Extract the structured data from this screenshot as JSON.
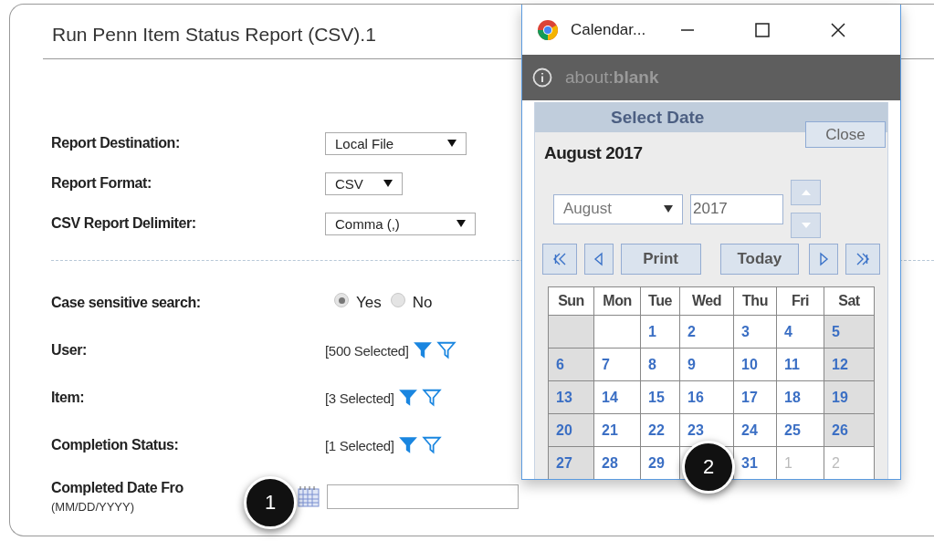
{
  "page": {
    "title": "Run Penn Item Status Report (CSV).1"
  },
  "selects": [
    {
      "label": "Report Destination:",
      "value": "Local File"
    },
    {
      "label": "Report Format:",
      "value": "CSV"
    },
    {
      "label": "CSV Report Delimiter:",
      "value": "Comma (,)"
    }
  ],
  "case_sensitive": {
    "label": "Case sensitive search:",
    "options": [
      {
        "label": "Yes",
        "selected": true
      },
      {
        "label": "No",
        "selected": false
      }
    ]
  },
  "filters": [
    {
      "label": "User:",
      "value": "[500 Selected]"
    },
    {
      "label": "Item:",
      "value": "[3 Selected]"
    },
    {
      "label": "Completion Status:",
      "value": "[1 Selected]"
    }
  ],
  "date_from": {
    "label": "Completed Date Fro",
    "hint": "(MM/DD/YYYY)"
  },
  "popup": {
    "title": "Calendar...",
    "address": "about:**blank**",
    "header": "Select Date",
    "close_button": "Close",
    "month_title": "August 2017",
    "month_select": "August",
    "year_value": "2017",
    "print_button": "Print",
    "today_button": "Today",
    "weekdays": [
      "Sun",
      "Mon",
      "Tue",
      "Wed",
      "Thu",
      "Fri",
      "Sat"
    ],
    "weeks": [
      [
        {
          "kind": "empty"
        },
        {
          "kind": "empty"
        },
        {
          "day": "1",
          "other_month": false
        },
        {
          "day": "2",
          "other_month": false
        },
        {
          "day": "3",
          "other_month": false
        },
        {
          "day": "4",
          "other_month": false
        },
        {
          "day": "5",
          "other_month": false
        }
      ],
      [
        {
          "day": "6",
          "other_month": false
        },
        {
          "day": "7",
          "other_month": false
        },
        {
          "day": "8",
          "other_month": false
        },
        {
          "day": "9",
          "other_month": false
        },
        {
          "day": "10",
          "other_month": false
        },
        {
          "day": "11",
          "other_month": false
        },
        {
          "day": "12",
          "other_month": false
        }
      ],
      [
        {
          "day": "13",
          "other_month": false
        },
        {
          "day": "14",
          "other_month": false
        },
        {
          "day": "15",
          "other_month": false
        },
        {
          "day": "16",
          "other_month": false
        },
        {
          "day": "17",
          "other_month": false
        },
        {
          "day": "18",
          "other_month": false
        },
        {
          "day": "19",
          "other_month": false
        }
      ],
      [
        {
          "day": "20",
          "other_month": false
        },
        {
          "day": "21",
          "other_month": false
        },
        {
          "day": "22",
          "other_month": false
        },
        {
          "day": "23",
          "other_month": false
        },
        {
          "day": "24",
          "other_month": false
        },
        {
          "day": "25",
          "other_month": false
        },
        {
          "day": "26",
          "other_month": false
        }
      ],
      [
        {
          "day": "27",
          "other_month": false
        },
        {
          "day": "28",
          "other_month": false
        },
        {
          "day": "29",
          "other_month": false
        },
        {
          "kind": "empty"
        },
        {
          "day": "31",
          "other_month": false
        },
        {
          "day": "1",
          "other_month": true
        },
        {
          "day": "2",
          "other_month": true
        }
      ]
    ]
  },
  "callouts": [
    "1",
    "2"
  ]
}
